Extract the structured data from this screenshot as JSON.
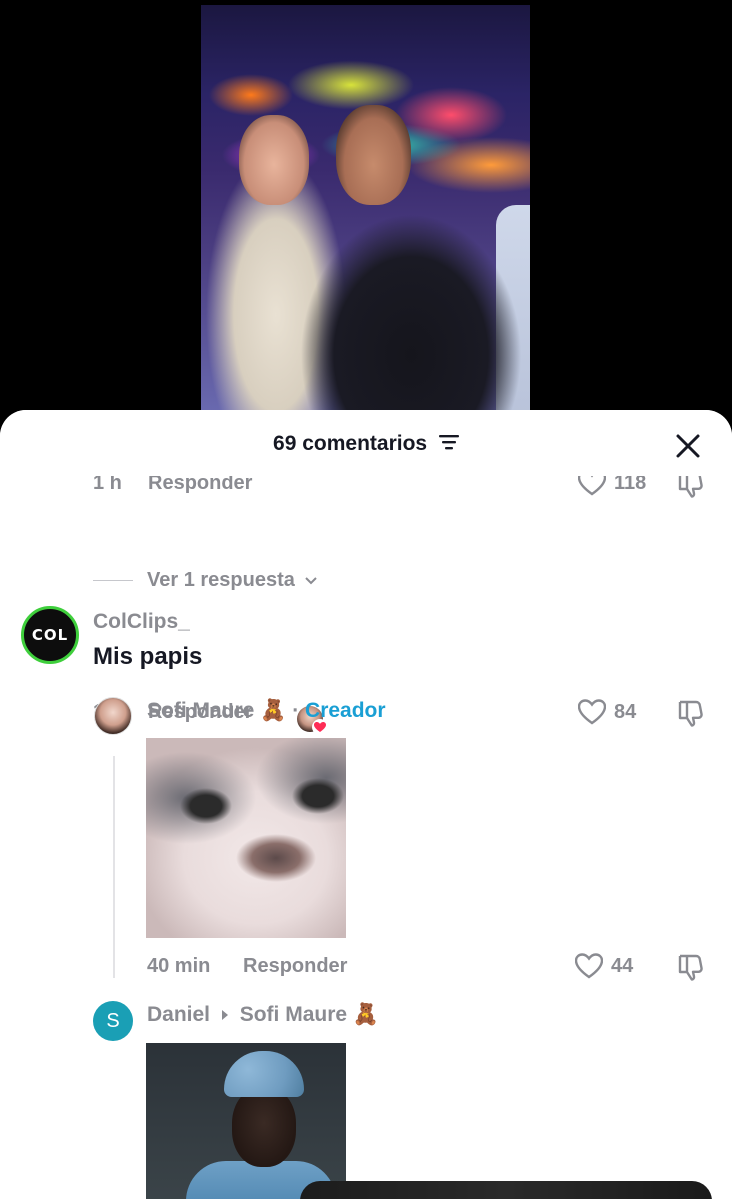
{
  "header": {
    "title": "69 comentarios"
  },
  "comments": {
    "previous": {
      "time": "1 h",
      "reply_label": "Responder",
      "like_count": "118",
      "view_replies": "Ver 1 respuesta"
    },
    "main": {
      "username": "ColClips_",
      "avatar_text": "COL",
      "text": "Mis papis",
      "time": "1 h",
      "reply_label": "Responder",
      "like_count": "84"
    },
    "reply1": {
      "username": "Sofi Maure 🧸",
      "separator": "·",
      "badge": "Creador",
      "time": "40 min",
      "reply_label": "Responder",
      "like_count": "44"
    },
    "reply2": {
      "avatar_letter": "S",
      "username": "Daniel",
      "reply_to": "Sofi Maure 🧸"
    }
  },
  "colors": {
    "accent": "#1a9fd4",
    "muted": "#8a8b91",
    "text": "#161823",
    "reaction_heart": "#fe2c55"
  }
}
